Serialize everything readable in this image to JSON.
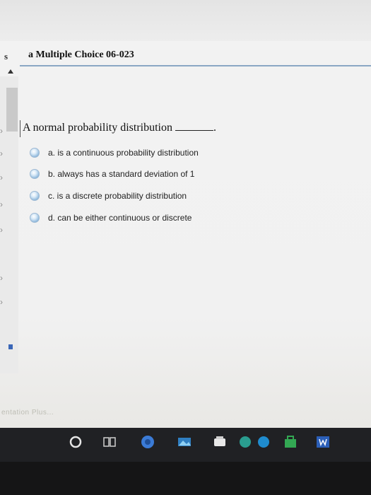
{
  "header": {
    "tab_letter": "s",
    "title": "a Multiple Choice 06-023"
  },
  "question": {
    "text": "A normal probability distribution",
    "end_punct": "."
  },
  "options": [
    {
      "label": "a. is a continuous probability distribution"
    },
    {
      "label": "b. always has a standard deviation of 1"
    },
    {
      "label": "c. is a discrete probability distribution"
    },
    {
      "label": "d. can be either continuous or discrete"
    }
  ],
  "footer": {
    "ghost_text": "entation Plus..."
  },
  "colors": {
    "accent_rule": "#8aa7c4",
    "radio_blue": "#8db7db",
    "taskbar": "#202124"
  }
}
